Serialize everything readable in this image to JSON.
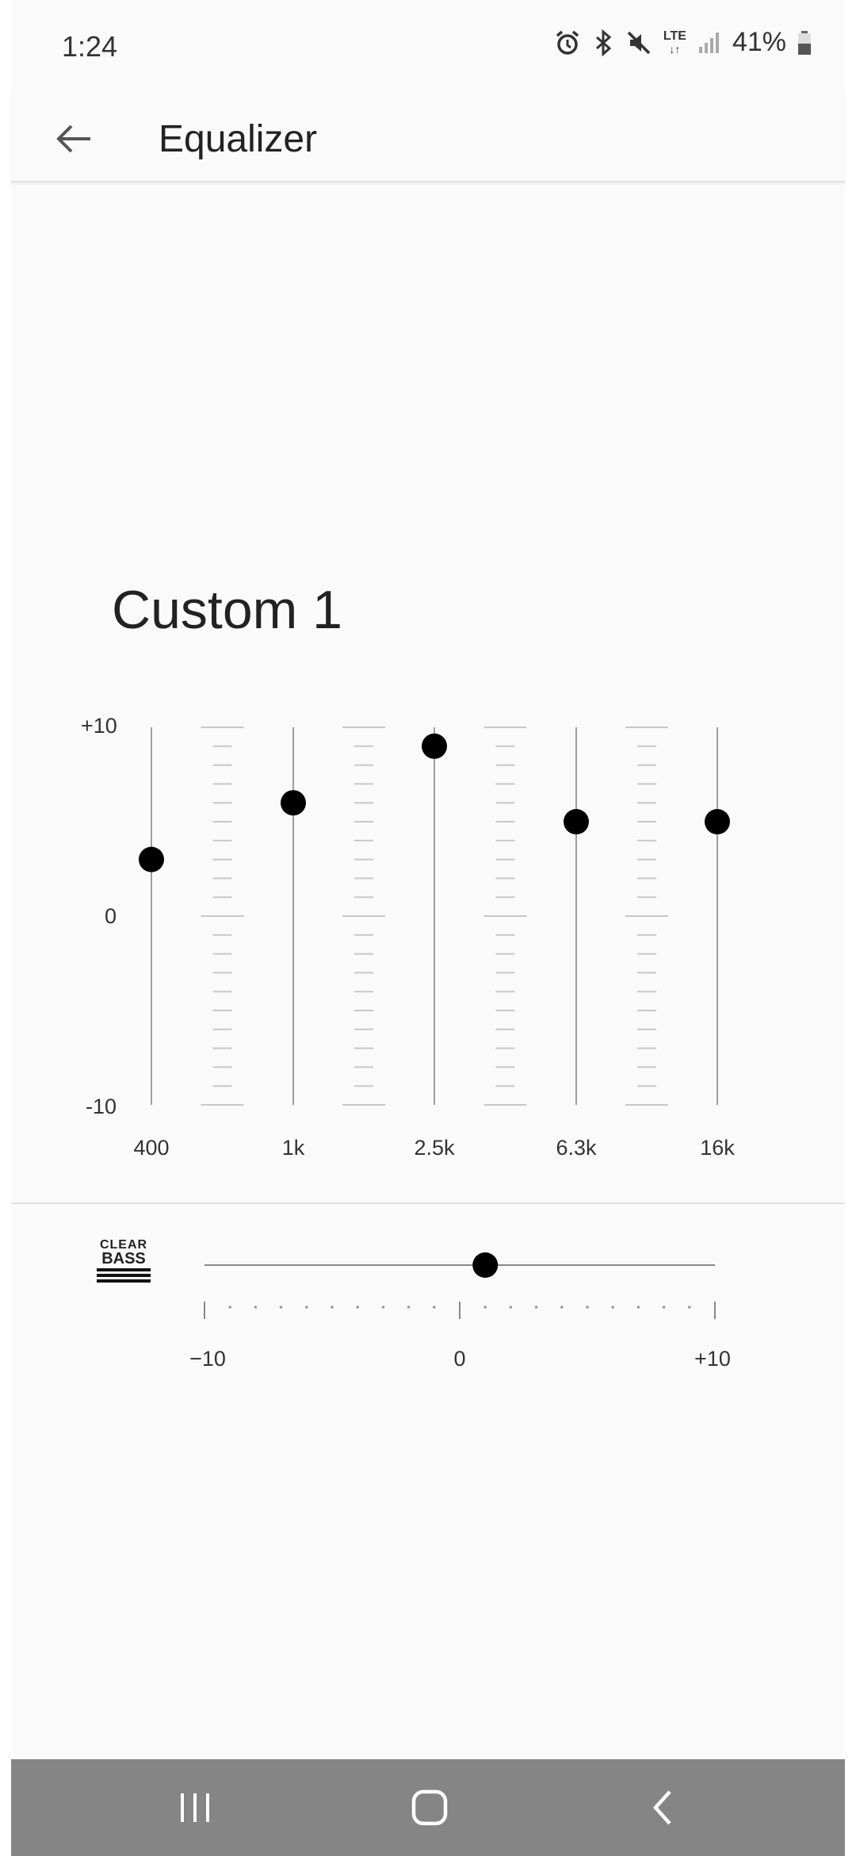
{
  "status_bar": {
    "time": "1:24",
    "network": "LTE",
    "battery": "41%",
    "icons": [
      "alarm-icon",
      "bluetooth-icon",
      "mute-icon",
      "lte-icon",
      "signal-icon",
      "battery-icon"
    ]
  },
  "app_bar": {
    "back_icon": "arrow-left-icon",
    "title": "Equalizer"
  },
  "preset": {
    "name": "Custom 1"
  },
  "equalizer": {
    "axis_labels": {
      "max": "+10",
      "mid": "0",
      "min": "-10"
    },
    "range": [
      -10,
      10
    ],
    "bands": [
      {
        "label": "400",
        "value": 3
      },
      {
        "label": "1k",
        "value": 6
      },
      {
        "label": "2.5k",
        "value": 9
      },
      {
        "label": "6.3k",
        "value": 5
      },
      {
        "label": "16k",
        "value": 5
      }
    ]
  },
  "clear_bass": {
    "logo_line1": "CLEAR",
    "logo_line2": "BASS",
    "value": 1,
    "range": [
      -10,
      10
    ],
    "tick_labels": {
      "min": "−10",
      "mid": "0",
      "max": "+10"
    }
  },
  "nav_bar": {
    "items": [
      "recents-icon",
      "home-icon",
      "back-icon"
    ]
  },
  "colors": {
    "knob": "#000000",
    "track": "#9e9e9e",
    "tick": "#c8c8c8",
    "nav_bg": "#858585"
  }
}
